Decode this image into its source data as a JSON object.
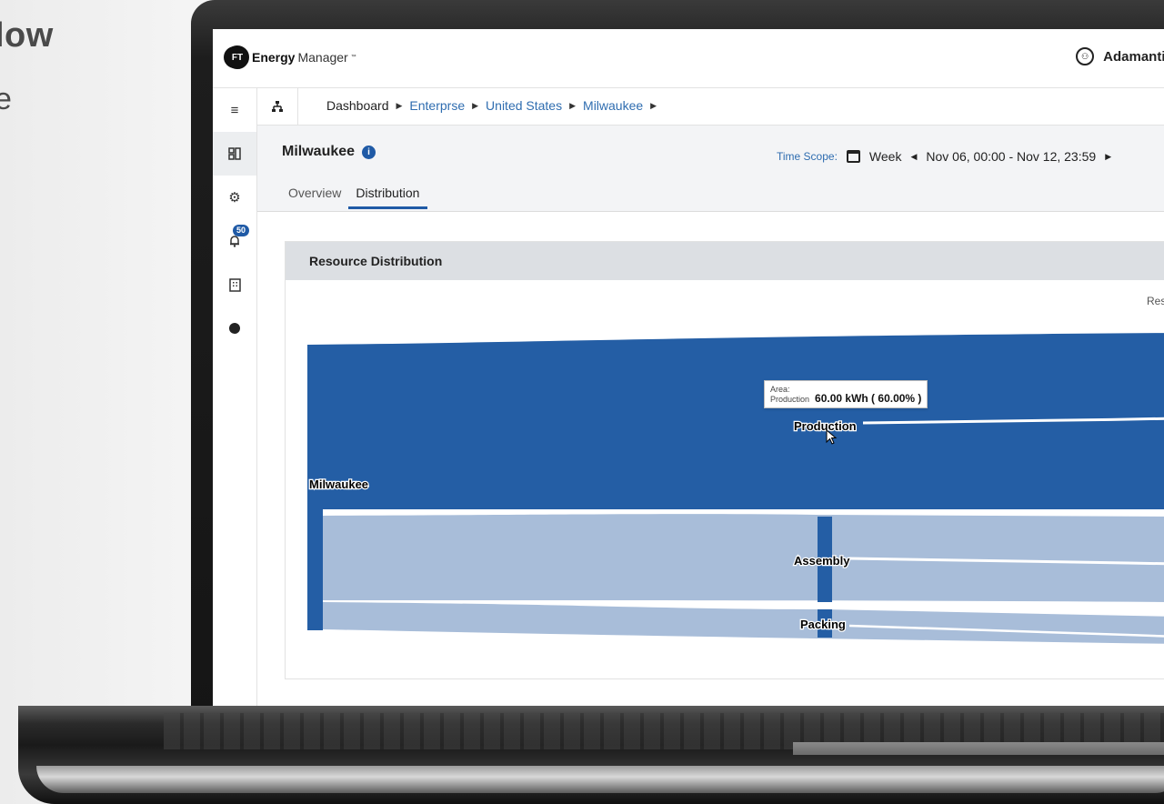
{
  "marketing": {
    "title": "low",
    "subtitle": "e"
  },
  "app": {
    "brand_strong": "Energy",
    "brand_light": "Manager",
    "brand_tm": "™",
    "logo_text": "FT",
    "org_name": "Adamantium"
  },
  "rail": [
    {
      "icon": "menu-icon",
      "glyph": "≡"
    },
    {
      "icon": "dashboard-icon",
      "glyph": "▯▯"
    },
    {
      "icon": "settings-icon",
      "glyph": "⚙"
    },
    {
      "icon": "bell-icon",
      "glyph": "🔔︎",
      "badge": "50"
    },
    {
      "icon": "building-icon",
      "glyph": "▦"
    },
    {
      "icon": "ft-logo-icon",
      "glyph": "●"
    }
  ],
  "breadcrumb": {
    "items": [
      "Dashboard",
      "Enterprse",
      "United States",
      "Milwaukee"
    ]
  },
  "page": {
    "title": "Milwaukee",
    "time_scope_label": "Time Scope:",
    "period": "Week",
    "range": "Nov 06, 00:00 - Nov 12, 23:59",
    "tabs": [
      "Overview",
      "Distribution"
    ],
    "active_tab": "Distribution"
  },
  "card": {
    "title": "Resource Distribution",
    "right_label": "Res"
  },
  "sankey": {
    "nodes": [
      {
        "name": "Milwaukee",
        "value": 100
      },
      {
        "name": "Production",
        "value": 60
      },
      {
        "name": "Assembly",
        "value": 30
      },
      {
        "name": "Packing",
        "value": 10
      }
    ],
    "links": [
      {
        "source": "Milwaukee",
        "target": "Production",
        "value": 60
      },
      {
        "source": "Milwaukee",
        "target": "Assembly",
        "value": 30
      },
      {
        "source": "Milwaukee",
        "target": "Packing",
        "value": 10
      }
    ],
    "colors": {
      "primary": "#245ea5",
      "secondary": "#a8bdd9"
    }
  },
  "tooltip": {
    "label_line1": "Area:",
    "label_line2": "Production",
    "value": "60.00 kWh ( 60.00% )"
  }
}
